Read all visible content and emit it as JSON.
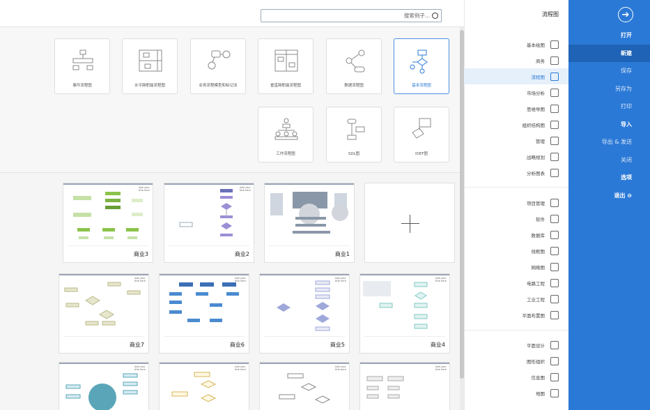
{
  "right_panel": {
    "back_icon": "arrow-circle-right-icon",
    "menu": [
      {
        "label": "打开",
        "style": "normal"
      },
      {
        "label": "新建",
        "style": "active"
      },
      {
        "label": "保存",
        "style": "light"
      },
      {
        "label": "另存为",
        "style": "light"
      },
      {
        "label": "打印",
        "style": "light"
      },
      {
        "label": "导入",
        "style": "normal"
      },
      {
        "label": "导出 & 发送",
        "style": "light"
      },
      {
        "label": "关闭",
        "style": "light"
      },
      {
        "label": "选项",
        "style": "normal"
      },
      {
        "label": "退出",
        "style": "normal"
      }
    ]
  },
  "categories": {
    "header": "流程图",
    "group1": [
      "基本绘图",
      "商务",
      "流程图",
      "市场分析",
      "思维导图",
      "组织结构图",
      "管理",
      "战略规划",
      "分析图表"
    ],
    "group2": [
      "项目管理",
      "软件",
      "数据库",
      "线框图",
      "网络图",
      "电路工程",
      "工业工程",
      "平面布置图"
    ],
    "group3": [
      "平面设计",
      "图形组织",
      "信息图",
      "地图"
    ],
    "active": "流程图"
  },
  "search": {
    "placeholder": "搜索例子..."
  },
  "templates": [
    {
      "label": "基本流程图",
      "selected": true
    },
    {
      "label": "数据流程图",
      "selected": false
    },
    {
      "label": "垂直跨职能流程图",
      "selected": false
    },
    {
      "label": "业务流程模型和标记法",
      "selected": false
    },
    {
      "label": "水平跨职能流程图",
      "selected": false
    },
    {
      "label": "事件流程图",
      "selected": false
    },
    {
      "label": "IDEF图",
      "selected": false
    },
    {
      "label": "SDL图",
      "selected": false
    },
    {
      "label": "工作流程图",
      "selected": false
    }
  ],
  "documents": [
    {
      "name": "商业1"
    },
    {
      "name": "商业2"
    },
    {
      "name": "商业3"
    },
    {
      "name": "商业4"
    },
    {
      "name": "商业5"
    },
    {
      "name": "商业6"
    },
    {
      "name": "商业7"
    }
  ],
  "doc_subtitle": "Add your title here",
  "colors": {
    "accent": "#2b79d6",
    "active_bg": "#e6f0fb",
    "green": "#8bc34a",
    "blue_node": "#3b6fb6",
    "purple": "#9c8fd6"
  }
}
